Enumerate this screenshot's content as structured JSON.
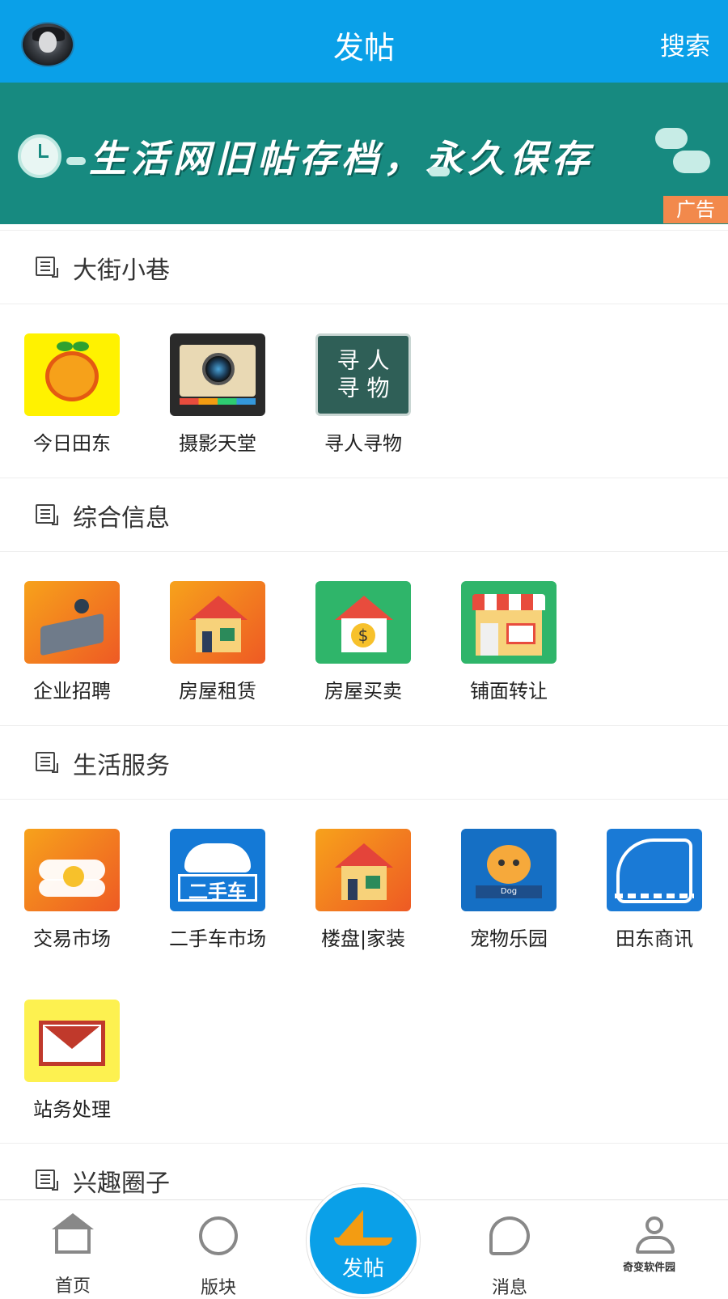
{
  "header": {
    "title": "发帖",
    "search_label": "搜索"
  },
  "banner": {
    "text": "生活网旧帖存档，永久保存",
    "ad_label": "广告"
  },
  "sections": [
    {
      "title": "大街小巷",
      "items": [
        {
          "label": "今日田东",
          "icon": "mango-icon"
        },
        {
          "label": "摄影天堂",
          "icon": "camera-icon"
        },
        {
          "label": "寻人寻物",
          "icon": "lost-found-icon",
          "icon_text": "寻 人\n寻 物"
        }
      ]
    },
    {
      "title": "综合信息",
      "items": [
        {
          "label": "企业招聘",
          "icon": "office-icon"
        },
        {
          "label": "房屋租赁",
          "icon": "house-icon"
        },
        {
          "label": "房屋买卖",
          "icon": "house-sale-icon"
        },
        {
          "label": "铺面转让",
          "icon": "shop-icon"
        }
      ]
    },
    {
      "title": "生活服务",
      "items": [
        {
          "label": "交易市场",
          "icon": "handshake-coin-icon"
        },
        {
          "label": "二手车市场",
          "icon": "car-icon",
          "icon_text": "二手车"
        },
        {
          "label": "楼盘|家装",
          "icon": "house-icon"
        },
        {
          "label": "宠物乐园",
          "icon": "dog-icon",
          "icon_text": "Dog"
        },
        {
          "label": "田东商讯",
          "icon": "fishing-icon"
        },
        {
          "label": "站务处理",
          "icon": "mail-icon"
        }
      ]
    },
    {
      "title": "兴趣圈子",
      "items": []
    }
  ],
  "bottom_nav": [
    {
      "label": "首页",
      "icon": "home-icon"
    },
    {
      "label": "版块",
      "icon": "compass-icon"
    },
    {
      "label": "发帖",
      "icon": "sailboat-icon"
    },
    {
      "label": "消息",
      "icon": "chat-icon"
    },
    {
      "label": "",
      "icon": "user-icon"
    }
  ],
  "watermark": "奇变软件园",
  "colors": {
    "header": "#0aa0e8",
    "banner": "#178a80",
    "ad_badge": "#f2894c"
  }
}
